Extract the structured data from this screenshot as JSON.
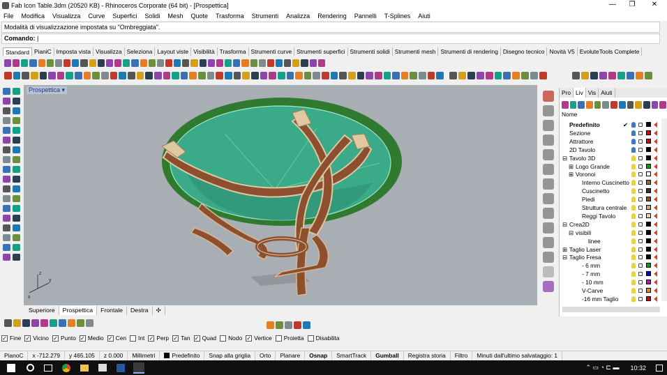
{
  "window": {
    "title": "Fab Icon Table.3dm (20520 KB) - Rhinoceros Corporate (64 bit) - [Prospettica]",
    "min": "—",
    "max": "❐",
    "close": "✕"
  },
  "menu": [
    "File",
    "Modifica",
    "Visualizza",
    "Curve",
    "Superfici",
    "Solidi",
    "Mesh",
    "Quote",
    "Trasforma",
    "Strumenti",
    "Analizza",
    "Rendering",
    "Pannelli",
    "T-Splines",
    "Aiuti"
  ],
  "command": {
    "history": "Modalità di visualizzazione impostata su \"Ombreggiata\".",
    "prompt": "Comando:"
  },
  "toolbar_tabs": [
    "Standard",
    "PianiC",
    "Imposta vista",
    "Visualizza",
    "Seleziona",
    "Layout viste",
    "Visibilità",
    "Trasforma",
    "Strumenti curve",
    "Strumenti superfici",
    "Strumenti solidi",
    "Strumenti mesh",
    "Strumenti di rendering",
    "Disegno tecnico",
    "Novità V5",
    "EvoluteTools Complete"
  ],
  "viewport": {
    "name": "Prospettica",
    "arrow": "▾"
  },
  "viewport_tabs": [
    "Superiore",
    "Prospettica",
    "Frontale",
    "Destra",
    "✣"
  ],
  "panel": {
    "tabs": [
      "Pro",
      "Liv",
      "Vis",
      "Aiuti"
    ],
    "col_name": "Nome",
    "layers": [
      {
        "name": "Predefinito",
        "indent": 0,
        "bold": true,
        "check": "✔",
        "color": "#000000"
      },
      {
        "name": "Sezione",
        "indent": 0,
        "color": "#dd0000"
      },
      {
        "name": "Attrattore",
        "indent": 0,
        "color": "#dd0000"
      },
      {
        "name": "2D Tavolo",
        "indent": 0,
        "color": "#000000"
      },
      {
        "name": "Tavolo 3D",
        "indent": 0,
        "exp": "⊟",
        "color": "#000000"
      },
      {
        "name": "Logo Grande",
        "indent": 1,
        "exp": "⊞",
        "color": "#00a000"
      },
      {
        "name": "Voronoi",
        "indent": 1,
        "exp": "⊞",
        "color": "#ffffff"
      },
      {
        "name": "Interno Cuscinetto",
        "indent": 2,
        "color": "#8c6446"
      },
      {
        "name": "Cuscinetto",
        "indent": 2,
        "color": "#333333"
      },
      {
        "name": "Piedi",
        "indent": 2,
        "color": "#8c4a20"
      },
      {
        "name": "Struttura centrale",
        "indent": 2,
        "color": "#c9a27a"
      },
      {
        "name": "Reggi Tavolo",
        "indent": 2,
        "color": "#e8d2b0"
      },
      {
        "name": "Crea2D",
        "indent": 0,
        "exp": "⊟",
        "color": "#000000"
      },
      {
        "name": "visibili",
        "indent": 1,
        "exp": "⊟",
        "color": "#000000"
      },
      {
        "name": "linee",
        "indent": 3,
        "color": "#000000"
      },
      {
        "name": "Taglio Laser",
        "indent": 0,
        "exp": "⊞",
        "color": "#000000"
      },
      {
        "name": "Taglio Fresa",
        "indent": 0,
        "exp": "⊟",
        "color": "#000000"
      },
      {
        "name": "- 6 mm",
        "indent": 2,
        "color": "#00a000"
      },
      {
        "name": "- 7 mm",
        "indent": 2,
        "color": "#0000dd"
      },
      {
        "name": "- 10 mm",
        "indent": 2,
        "color": "#cc00cc"
      },
      {
        "name": "V-Carve",
        "indent": 2,
        "color": "#ee8800"
      },
      {
        "name": "-16 mm Taglio",
        "indent": 2,
        "color": "#dd0000"
      }
    ]
  },
  "osnap": [
    {
      "label": "Fine",
      "checked": true
    },
    {
      "label": "Vicino",
      "checked": true
    },
    {
      "label": "Punto",
      "checked": true
    },
    {
      "label": "Medio",
      "checked": true
    },
    {
      "label": "Cen",
      "checked": true
    },
    {
      "label": "Int",
      "checked": false
    },
    {
      "label": "Perp",
      "checked": true
    },
    {
      "label": "Tan",
      "checked": true
    },
    {
      "label": "Quad",
      "checked": true
    },
    {
      "label": "Nodo",
      "checked": false
    },
    {
      "label": "Vertice",
      "checked": true
    },
    {
      "label": "Proietta",
      "checked": false
    },
    {
      "label": "Disabilita",
      "checked": false
    }
  ],
  "status": [
    {
      "t": "PianoC",
      "b": false
    },
    {
      "t": "x -712.279",
      "b": false
    },
    {
      "t": "y 465.105",
      "b": false
    },
    {
      "t": "z 0.000",
      "b": false
    },
    {
      "t": "Millimetri",
      "b": false
    },
    {
      "t": "Predefinito",
      "b": false,
      "sw": true
    },
    {
      "t": "Snap alla griglia",
      "b": false
    },
    {
      "t": "Orto",
      "b": false
    },
    {
      "t": "Planare",
      "b": false
    },
    {
      "t": "Osnap",
      "b": true
    },
    {
      "t": "SmartTrack",
      "b": false
    },
    {
      "t": "Gumball",
      "b": true
    },
    {
      "t": "Registra storia",
      "b": false
    },
    {
      "t": "Filtro",
      "b": false
    },
    {
      "t": "Minuti dall'ultimo salvataggio: 1",
      "b": false
    }
  ],
  "taskbar": {
    "time": "10:32"
  },
  "colors": {
    "table_top": "#2f7a2f",
    "glass": "#3aaa88",
    "wood": "#8c5030",
    "frame": "#e0c8a0"
  }
}
